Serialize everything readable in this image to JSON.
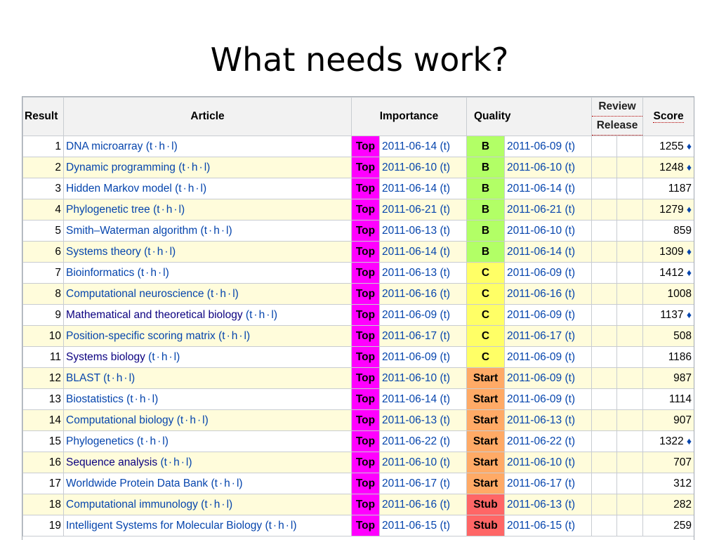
{
  "slide_title": "What needs work?",
  "headers": {
    "result": "Result",
    "article": "Article",
    "importance": "Importance",
    "quality": "Quality",
    "review": "Review",
    "release": "Release",
    "score": "Score"
  },
  "colors": {
    "Top": "#ff00ff",
    "B": "#b2ff66",
    "C": "#ffff66",
    "Start": "#ffaa66",
    "Stub": "#ff6666"
  },
  "rows": [
    {
      "result": "1",
      "article": "DNA microarray",
      "imp": "Top",
      "imp_date": "2011-06-14",
      "qual": "B",
      "qual_date": "2011-06-09",
      "score": "1255",
      "diamond": true
    },
    {
      "result": "2",
      "article": "Dynamic programming",
      "imp": "Top",
      "imp_date": "2011-06-10",
      "qual": "B",
      "qual_date": "2011-06-10",
      "score": "1248",
      "diamond": true
    },
    {
      "result": "3",
      "article": "Hidden Markov model",
      "imp": "Top",
      "imp_date": "2011-06-14",
      "qual": "B",
      "qual_date": "2011-06-14",
      "score": "1187",
      "diamond": false
    },
    {
      "result": "4",
      "article": "Phylogenetic tree",
      "imp": "Top",
      "imp_date": "2011-06-21",
      "qual": "B",
      "qual_date": "2011-06-21",
      "score": "1279",
      "diamond": true
    },
    {
      "result": "5",
      "article": "Smith–Waterman algorithm",
      "imp": "Top",
      "imp_date": "2011-06-13",
      "qual": "B",
      "qual_date": "2011-06-10",
      "score": "859",
      "diamond": false
    },
    {
      "result": "6",
      "article": "Systems theory",
      "imp": "Top",
      "imp_date": "2011-06-14",
      "qual": "B",
      "qual_date": "2011-06-14",
      "score": "1309",
      "diamond": true
    },
    {
      "result": "7",
      "article": "Bioinformatics",
      "imp": "Top",
      "imp_date": "2011-06-13",
      "qual": "C",
      "qual_date": "2011-06-09",
      "score": "1412",
      "diamond": true
    },
    {
      "result": "8",
      "article": "Computational neuroscience",
      "imp": "Top",
      "imp_date": "2011-06-16",
      "qual": "C",
      "qual_date": "2011-06-16",
      "score": "1008",
      "diamond": false
    },
    {
      "result": "9",
      "article": "Mathematical and theoretical biology",
      "imp": "Top",
      "imp_date": "2011-06-09",
      "qual": "C",
      "qual_date": "2011-06-09",
      "score": "1137",
      "diamond": true,
      "visited": true
    },
    {
      "result": "10",
      "article": "Position-specific scoring matrix",
      "imp": "Top",
      "imp_date": "2011-06-17",
      "qual": "C",
      "qual_date": "2011-06-17",
      "score": "508",
      "diamond": false
    },
    {
      "result": "11",
      "article": "Systems biology",
      "imp": "Top",
      "imp_date": "2011-06-09",
      "qual": "C",
      "qual_date": "2011-06-09",
      "score": "1186",
      "diamond": false,
      "visited": true
    },
    {
      "result": "12",
      "article": "BLAST",
      "imp": "Top",
      "imp_date": "2011-06-10",
      "qual": "Start",
      "qual_date": "2011-06-09",
      "score": "987",
      "diamond": false
    },
    {
      "result": "13",
      "article": "Biostatistics",
      "imp": "Top",
      "imp_date": "2011-06-14",
      "qual": "Start",
      "qual_date": "2011-06-09",
      "score": "1114",
      "diamond": false
    },
    {
      "result": "14",
      "article": "Computational biology",
      "imp": "Top",
      "imp_date": "2011-06-13",
      "qual": "Start",
      "qual_date": "2011-06-13",
      "score": "907",
      "diamond": false
    },
    {
      "result": "15",
      "article": "Phylogenetics",
      "imp": "Top",
      "imp_date": "2011-06-22",
      "qual": "Start",
      "qual_date": "2011-06-22",
      "score": "1322",
      "diamond": true
    },
    {
      "result": "16",
      "article": "Sequence analysis",
      "imp": "Top",
      "imp_date": "2011-06-10",
      "qual": "Start",
      "qual_date": "2011-06-10",
      "score": "707",
      "diamond": false,
      "visited": true
    },
    {
      "result": "17",
      "article": "Worldwide Protein Data Bank",
      "imp": "Top",
      "imp_date": "2011-06-17",
      "qual": "Start",
      "qual_date": "2011-06-17",
      "score": "312",
      "diamond": false
    },
    {
      "result": "18",
      "article": "Computational immunology",
      "imp": "Top",
      "imp_date": "2011-06-16",
      "qual": "Stub",
      "qual_date": "2011-06-13",
      "score": "282",
      "diamond": false
    },
    {
      "result": "19",
      "article": "Intelligent Systems for Molecular Biology",
      "imp": "Top",
      "imp_date": "2011-06-15",
      "qual": "Stub",
      "qual_date": "2011-06-15",
      "score": "259",
      "diamond": false
    }
  ],
  "aux_links": {
    "t": "t",
    "h": "h",
    "l": "l",
    "date_link": "(t)",
    "separator": "·",
    "diamond": "♦"
  }
}
